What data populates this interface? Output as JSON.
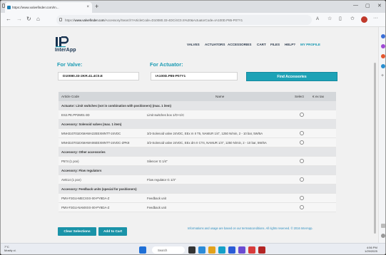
{
  "browser": {
    "tab_title": "https://www.valvefinder.com/In...",
    "tab_close": "×",
    "new_tab": "+",
    "address_prefix": "https://",
    "address_host": "www.valvefinder.com",
    "address_rest": "/Accessory/Search?ArticleCode=D10080.33-4DC/4C0.S%20&ActuatorCode=IA100D.P85-P07Y1",
    "minimize": "—",
    "maximize": "▢",
    "close": "✕"
  },
  "site": {
    "logo": "InterApp",
    "nav": [
      {
        "label": "VALVES",
        "active": false
      },
      {
        "label": "ACTUATORS",
        "active": false
      },
      {
        "label": "ACCESSORIES",
        "active": false
      },
      {
        "label": "CART",
        "active": false
      },
      {
        "label": "FILES",
        "active": false
      },
      {
        "label": "HELP?",
        "active": false
      },
      {
        "label": "MY PROFILE",
        "active": true
      }
    ]
  },
  "form": {
    "valve_label": "For Valve:",
    "valve_value": "D10080.33-2KR.41.4C0.E",
    "actuator_label": "For Actuator:",
    "actuator_value": "IA100D.P85-P07Y1",
    "find_button": "Find Accessories"
  },
  "table": {
    "headers": {
      "code": "Article Code",
      "name": "Name",
      "select": "Select",
      "qty": "€ ex tax"
    },
    "rows": [
      {
        "type": "cat",
        "code": "Actuator: Limit switches (not in combination with positioners) (max. 1 item)"
      },
      {
        "type": "item",
        "code": "ES2.PE.PP2M01-3D",
        "name": "Limit switches box 1/O+1/C"
      },
      {
        "type": "cat",
        "code": "Accessory: Solenoid valves (max. 1 item)"
      },
      {
        "type": "item",
        "code": "MNH310701EXMAWA22EEXMNTT-24VDC",
        "name": "3/2-Solenoid valve 24VDC, EEx m II T5, NAMUR 1/4\", 1250 N/min, 2 - 10 bar, 5W/5A"
      },
      {
        "type": "item",
        "code": "MNH310701EXMAWA06EEXMNTT-24VDC-ZPK8",
        "name": "3/2-Solenoid valve 24VDC, EEx dm II CT4, NAMUR 1/4\", 1250 N/min, 2 - 10 bar, 5W/5A"
      },
      {
        "type": "cat",
        "code": "Accessory: Other accessories"
      },
      {
        "type": "item",
        "code": "P574 (1 pce)",
        "name": "Silencer G 1/4\""
      },
      {
        "type": "cat",
        "code": "Accessory: Flow regulators"
      },
      {
        "type": "item",
        "code": "AVE14 (1 pce)",
        "name": "Flow regulator G 1/4\""
      },
      {
        "type": "cat",
        "code": "Accessory: Feedback units (special for positioners)"
      },
      {
        "type": "item",
        "code": "PMV-F3GU-MECXXX-00-PY8DA-Z",
        "name": "Feedback unit"
      },
      {
        "type": "item",
        "code": "PMV-F3GU-NAMXXX-00-PY8DA-Z",
        "name": "Feedback unit"
      }
    ]
  },
  "footer": {
    "clear_button": "Clear Selections",
    "add_button": "Add to Cart",
    "note": "Informations and usage are based on our terms&conditions. All rights reserved. © 2016 InterApp."
  },
  "taskbar": {
    "weather_temp": "7°C",
    "weather_desc": "Mostly cl.",
    "search": "Search",
    "time": "4:56 PM",
    "date": "1/29/2025"
  }
}
